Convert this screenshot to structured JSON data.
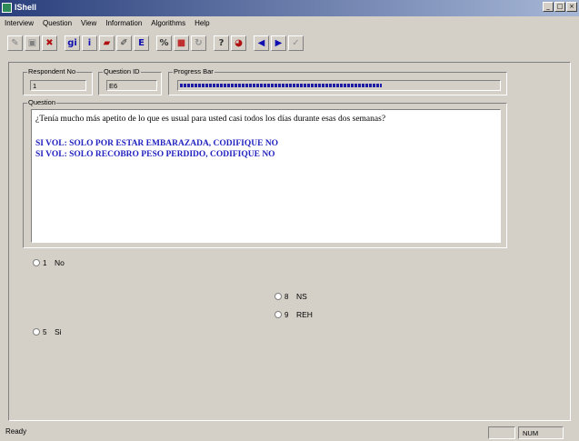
{
  "window": {
    "title": "IShell",
    "controls": [
      "_",
      "□",
      "×"
    ]
  },
  "menu": [
    "Interview",
    "Question",
    "View",
    "Information",
    "Algorithms",
    "Help"
  ],
  "toolbar": {
    "buttons": [
      {
        "name": "pencil-icon",
        "glyph": "✎",
        "color": "#808080"
      },
      {
        "name": "notes-icon",
        "glyph": "▣",
        "color": "#808080"
      },
      {
        "name": "cross-icon",
        "glyph": "✖",
        "color": "#b01010"
      },
      {
        "name": "info-gi-icon",
        "glyph": "gi",
        "color": "#1010b0"
      },
      {
        "name": "info-icon",
        "glyph": "i",
        "color": "#1010b0"
      },
      {
        "name": "flag-icon",
        "glyph": "▰",
        "color": "#b01010"
      },
      {
        "name": "edit-icon",
        "glyph": "✐",
        "color": "#303030"
      },
      {
        "name": "ref-icon",
        "glyph": "E",
        "color": "#1010b0"
      },
      {
        "name": "stats-icon",
        "glyph": "%",
        "color": "#303030"
      },
      {
        "name": "palette-icon",
        "glyph": "■",
        "color": "#c03030"
      },
      {
        "name": "refresh-icon",
        "glyph": "↻",
        "color": "#909090"
      },
      {
        "name": "help-icon",
        "glyph": "?",
        "color": "#303030"
      },
      {
        "name": "erase-icon",
        "glyph": "◕",
        "color": "#b01010"
      },
      {
        "name": "prev-icon",
        "glyph": "◀",
        "color": "#1010b0"
      },
      {
        "name": "next-icon",
        "glyph": "▶",
        "color": "#1010b0"
      },
      {
        "name": "check-icon",
        "glyph": "✓",
        "color": "#909090"
      }
    ]
  },
  "respondent": {
    "label": "Respondent No",
    "value": "1"
  },
  "question_id": {
    "label": "Question ID",
    "value": "E6"
  },
  "progress": {
    "label": "Progress Bar",
    "value": 0.63
  },
  "question": {
    "label": "Question",
    "text": "¿Tenía mucho más apetito de lo que es usual para usted casi todos los días durante esas dos semanas?",
    "instructions": [
      "SI VOL:  SOLO POR ESTAR EMBARAZADA, CODIFIQUE NO",
      "SI VOL:  SOLO RECOBRO PESO PERDIDO, CODIFIQUE NO"
    ]
  },
  "options": [
    {
      "code": "1",
      "label": "No"
    },
    {
      "code": "5",
      "label": "Si"
    },
    {
      "code": "8",
      "label": "NS"
    },
    {
      "code": "9",
      "label": "REH"
    }
  ],
  "status": {
    "text": "Ready",
    "num": "NUM"
  }
}
